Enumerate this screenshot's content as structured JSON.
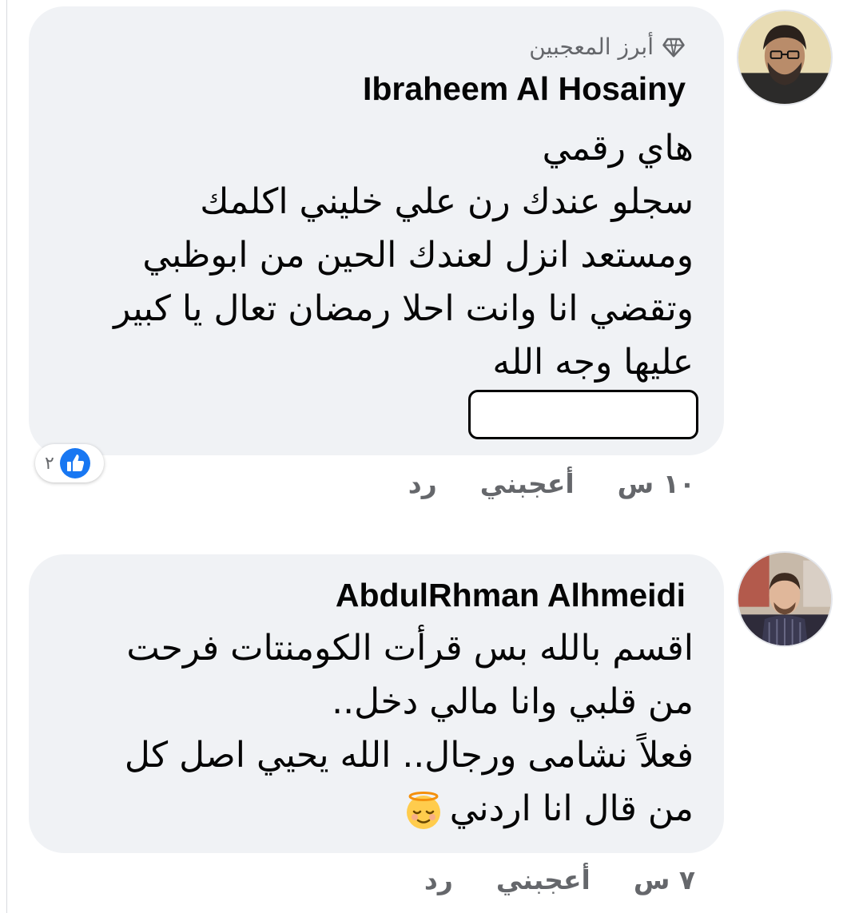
{
  "comments": [
    {
      "badge_label": "أبرز المعجبين",
      "badge_icon": "diamond-icon",
      "author": "Ibraheem Al Hosainy",
      "lines": [
        "هاي رقمي",
        "سجلو عندك رن علي خليني اكلمك",
        "ومستعد انزل لعندك الحين من ابوظبي",
        "وتقضي انا وانت احلا رمضان تعال يا كبير",
        "عليها وجه الله"
      ],
      "redacted": true,
      "reaction_count": "٢",
      "reaction_icon": "like-icon",
      "time": "١٠ س",
      "like_label": "أعجبني",
      "reply_label": "رد"
    },
    {
      "author": "AbdulRhman Alhmeidi",
      "lines": [
        "اقسم بالله بس قرأت الكومنتات فرحت",
        "من قلبي وانا مالي دخل..",
        "فعلاً نشامى ورجال.. الله يحيي اصل كل",
        "من قال انا اردني"
      ],
      "emoji": "innocent-face-emoji",
      "time": "٧ س",
      "like_label": "أعجبني",
      "reply_label": "رد"
    }
  ],
  "colors": {
    "bubble": "#f0f2f5",
    "meta_text": "#65676b",
    "like_blue": "#1877f2"
  }
}
